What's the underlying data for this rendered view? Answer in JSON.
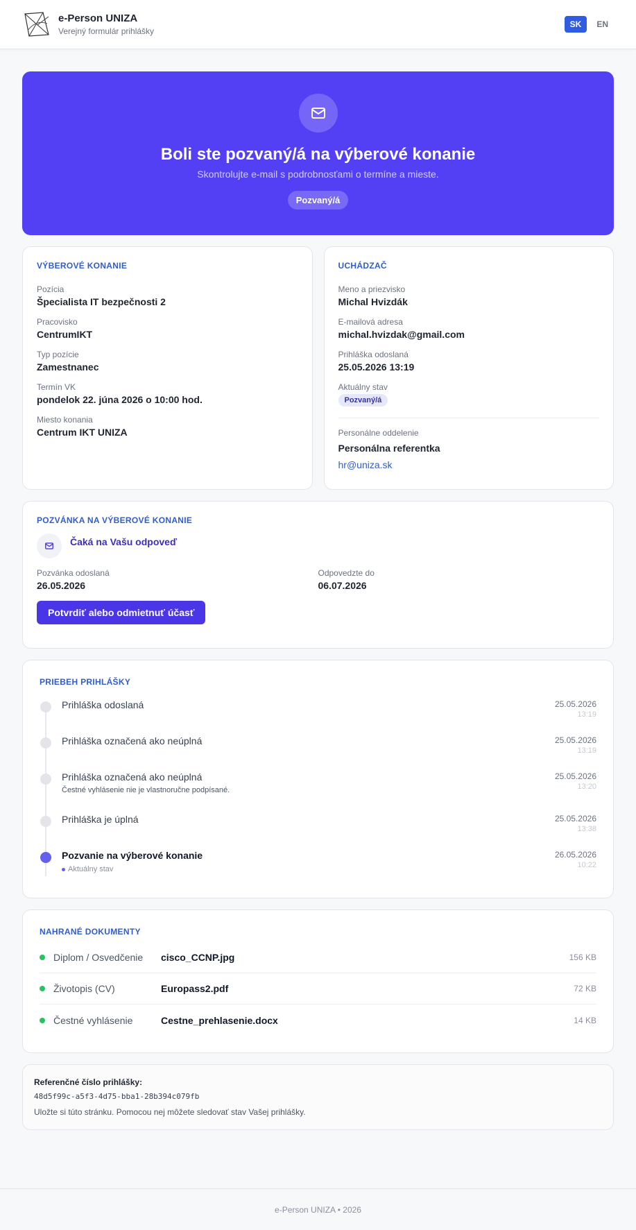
{
  "header": {
    "title": "e-Person UNIZA",
    "subtitle": "Verejný formulár prihlášky",
    "languages": [
      "SK",
      "EN"
    ],
    "active_language": "SK"
  },
  "hero": {
    "title": "Boli ste pozvaný/á na výberové konanie",
    "subtitle": "Skontrolujte e-mail s podrobnosťami o termíne a mieste.",
    "badge": "Pozvaný/á",
    "icon": "mail-icon"
  },
  "selection": {
    "title": "Výberové konanie",
    "fields": [
      {
        "label": "Pozícia",
        "value": "Špecialista IT bezpečnosti 2"
      },
      {
        "label": "Pracovisko",
        "value": "CentrumIKT"
      },
      {
        "label": "Typ pozície",
        "value": "Zamestnanec"
      },
      {
        "label": "Termín VK",
        "value": "pondelok 22. júna 2026 o 10:00 hod."
      },
      {
        "label": "Miesto konania",
        "value": "Centrum IKT UNIZA"
      }
    ]
  },
  "applicant": {
    "title": "Uchádzač",
    "fields": [
      {
        "label": "Meno a priezvisko",
        "value": "Michal Hvizdák"
      },
      {
        "label": "E-mailová adresa",
        "value": "michal.hvizdak@gmail.com"
      },
      {
        "label": "Prihláška odoslaná",
        "value": "25.05.2026 13:19"
      }
    ],
    "status_label": "Aktuálny stav",
    "status_value": "Pozvaný/á",
    "hr_label": "Personálne oddelenie",
    "hr_name": "Personálna referentka",
    "hr_email": "hr@uniza.sk"
  },
  "invitation": {
    "title": "Pozvánka na výberové konanie",
    "status": "Čaká na Vašu odpoveď",
    "sent_label": "Pozvánka odoslaná",
    "sent_value": "26.05.2026",
    "respond_label": "Odpovedzte do",
    "respond_value": "06.07.2026",
    "button": "Potvrdiť alebo odmietnuť účasť"
  },
  "timeline": {
    "title": "Priebeh prihlášky",
    "current_label": "Aktuálny stav",
    "items": [
      {
        "title": "Prihláška odoslaná",
        "note": "",
        "date": "25.05.2026",
        "time": "13:19",
        "current": false
      },
      {
        "title": "Prihláška označená ako neúplná",
        "note": "",
        "date": "25.05.2026",
        "time": "13:19",
        "current": false
      },
      {
        "title": "Prihláška označená ako neúplná",
        "note": "Čestné vyhlásenie nie je vlastnoručne podpísané.",
        "date": "25.05.2026",
        "time": "13:20",
        "current": false
      },
      {
        "title": "Prihláška je úplná",
        "note": "",
        "date": "25.05.2026",
        "time": "13:38",
        "current": false
      },
      {
        "title": "Pozvanie na výberové konanie",
        "note": "",
        "date": "26.05.2026",
        "time": "10:22",
        "current": true
      }
    ]
  },
  "documents": {
    "title": "Nahrané dokumenty",
    "status_color": "#22c55e",
    "items": [
      {
        "type": "Diplom / Osvedčenie",
        "file": "cisco_CCNP.jpg",
        "size": "156 KB"
      },
      {
        "type": "Životopis (CV)",
        "file": "Europass2.pdf",
        "size": "72 KB"
      },
      {
        "type": "Čestné vyhlásenie",
        "file": "Cestne_prehlasenie.docx",
        "size": "14 KB"
      }
    ]
  },
  "reference": {
    "label": "Referenčné číslo prihlášky:",
    "id": "48d5f99c-a5f3-4d75-bba1-28b394c079fb",
    "note": "Uložte si túto stránku. Pomocou nej môžete sledovať stav Vašej prihlášky."
  },
  "footer": {
    "text": "e-Person UNIZA • 2026"
  },
  "colors": {
    "accent": "#5340f5",
    "button": "#4a36e6",
    "link": "#2f5ccf",
    "language_active": "#2f5ce0"
  }
}
